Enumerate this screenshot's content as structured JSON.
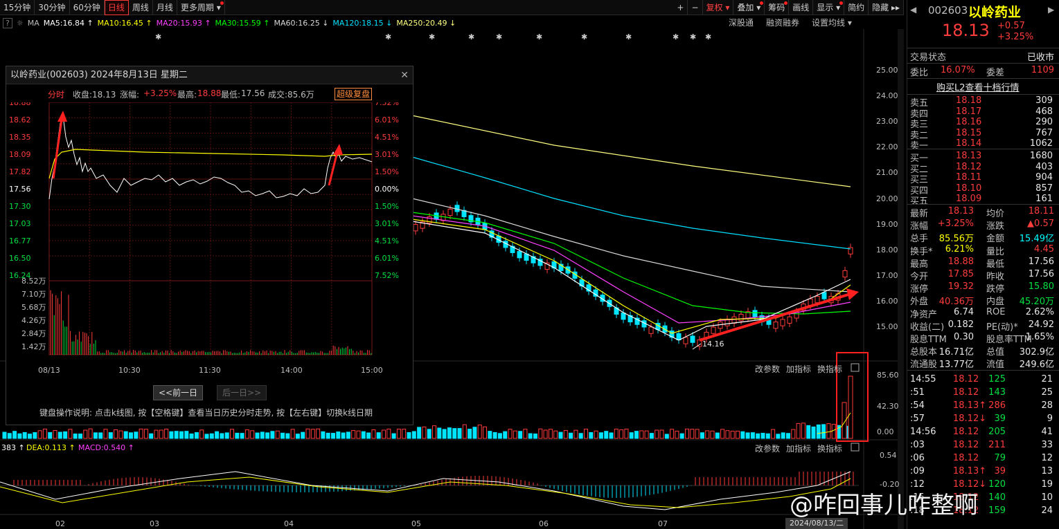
{
  "toolbar": {
    "periods": [
      "15分钟",
      "30分钟",
      "60分钟",
      "日线",
      "周线",
      "月线",
      "更多周期"
    ],
    "active": "日线",
    "right_items": [
      "+",
      "−",
      "复权",
      "叠加",
      "筹码",
      "画线",
      "显示",
      "简约",
      "隐藏"
    ]
  },
  "ma": {
    "prefix": "MA",
    "items": [
      {
        "label": "MA5:16.84",
        "color": "#ffffff"
      },
      {
        "label": "MA10:16.45",
        "color": "#ffff00"
      },
      {
        "label": "MA20:15.93",
        "color": "#ff40ff"
      },
      {
        "label": "MA30:15.59",
        "color": "#00ff00"
      },
      {
        "label": "MA60:16.25",
        "color": "#d8d8d8"
      },
      {
        "label": "MA120:18.15",
        "color": "#00e0ff"
      },
      {
        "label": "MA250:20.49",
        "color": "#ffff80"
      }
    ],
    "extras": [
      "深股通",
      "融资融券",
      "设置均线"
    ]
  },
  "axis": {
    "price_ticks": [
      "25.00",
      "24.00",
      "23.00",
      "22.00",
      "21.00",
      "20.00",
      "19.00",
      "18.00",
      "17.00",
      "16.00",
      "15.00"
    ],
    "vol_ticks": [
      "85.60",
      "42.30",
      "0.00"
    ],
    "macd_ticks": [
      "0.54",
      "-0.20"
    ],
    "months": [
      "02",
      "03",
      "04",
      "05",
      "06",
      "07"
    ],
    "low_label": "14.16"
  },
  "vol_panel": {
    "buttons": [
      "改参数",
      "加指标",
      "换指标"
    ]
  },
  "macd_panel": {
    "labels": [
      {
        "text": "383 ↑",
        "color": "#ffffff"
      },
      {
        "text": "DEA:0.113 ↑",
        "color": "#ffff00"
      },
      {
        "text": "MACD:0.540 ↑",
        "color": "#ff40ff"
      }
    ],
    "buttons": [
      "改参数",
      "加指标",
      "换指标"
    ]
  },
  "popup": {
    "title": "以岭药业(002603) 2024年8月13日 星期二",
    "tab": "分时",
    "close": "收盘:18.13",
    "change_label": "涨幅:",
    "change": "+3.25%",
    "high_label": "最高:",
    "high": "18.88",
    "low_label": "最低:",
    "low": "17.56",
    "volume": "成交:85.6万",
    "super_btn": "超级复盘",
    "left_ticks": [
      "18.88",
      "18.62",
      "18.35",
      "18.09",
      "17.82",
      "17.56",
      "17.30",
      "17.03",
      "16.77",
      "16.50",
      "16.24"
    ],
    "right_ticks": [
      "7.52%",
      "6.01%",
      "4.51%",
      "3.01%",
      "1.50%",
      "0.00%",
      "1.50%",
      "3.01%",
      "4.51%",
      "6.01%",
      "7.52%"
    ],
    "vol_ticks": [
      "8.52万",
      "7.10万",
      "5.68万",
      "4.26万",
      "2.84万",
      "1.42万"
    ],
    "time_ticks": [
      "08/13",
      "10:30",
      "11:30",
      "14:00",
      "15:00"
    ],
    "prev_btn": "<<前一日",
    "next_btn": "后一日>>",
    "help": "键盘操作说明: 点击k线图, 按【空格键】查看当日历史分时走势, 按【左右键】切换k线日期"
  },
  "stock": {
    "code": "002603",
    "name": "以岭药业",
    "price": "18.13",
    "change": "+0.57",
    "pct": "+3.25%"
  },
  "status": {
    "label": "交易状态",
    "value": "已收市"
  },
  "weibi": {
    "l1": "委比",
    "v1": "16.07%",
    "l2": "委差",
    "v2": "1109"
  },
  "l2_btn": "购买L2查看十档行情",
  "asks": [
    {
      "label": "卖五",
      "price": "18.18",
      "vol": "309"
    },
    {
      "label": "卖四",
      "price": "18.17",
      "vol": "468"
    },
    {
      "label": "卖三",
      "price": "18.16",
      "vol": "290"
    },
    {
      "label": "卖二",
      "price": "18.15",
      "vol": "767"
    },
    {
      "label": "卖一",
      "price": "18.14",
      "vol": "1062"
    }
  ],
  "bids": [
    {
      "label": "买一",
      "price": "18.13",
      "vol": "1680"
    },
    {
      "label": "买二",
      "price": "18.12",
      "vol": "403"
    },
    {
      "label": "买三",
      "price": "18.11",
      "vol": "904"
    },
    {
      "label": "买四",
      "price": "18.10",
      "vol": "857"
    },
    {
      "label": "买五",
      "price": "18.09",
      "vol": "161"
    }
  ],
  "stats": [
    {
      "l1": "最新",
      "v1": "18.13",
      "c1": "red",
      "l2": "均价",
      "v2": "18.11",
      "c2": "red"
    },
    {
      "l1": "涨幅",
      "v1": "+3.25%",
      "c1": "red",
      "l2": "涨跌",
      "v2": "▲0.57",
      "c2": "red"
    },
    {
      "l1": "总手",
      "v1": "85.56万",
      "c1": "yellow",
      "l2": "金额",
      "v2": "15.49亿",
      "c2": "cyan"
    },
    {
      "l1": "换手*",
      "v1": "6.21%",
      "c1": "yellow",
      "l2": "量比",
      "v2": "4.45",
      "c2": "red"
    },
    {
      "l1": "最高",
      "v1": "18.88",
      "c1": "red",
      "l2": "最低",
      "v2": "17.56",
      "c2": "white"
    },
    {
      "l1": "今开",
      "v1": "17.85",
      "c1": "red",
      "l2": "昨收",
      "v2": "17.56",
      "c2": "white"
    },
    {
      "l1": "涨停",
      "v1": "19.32",
      "c1": "red",
      "l2": "跌停",
      "v2": "15.80",
      "c2": "green"
    },
    {
      "l1": "外盘",
      "v1": "40.36万",
      "c1": "red",
      "l2": "内盘",
      "v2": "45.20万",
      "c2": "green"
    },
    {
      "l1": "净资产",
      "v1": "6.74",
      "c1": "white",
      "l2": "ROE",
      "v2": "2.62%",
      "c2": "white"
    },
    {
      "l1": "收益(二)",
      "v1": "0.182",
      "c1": "white",
      "l2": "PE(动)*",
      "v2": "24.92",
      "c2": "white"
    },
    {
      "l1": "股息TTM",
      "v1": "0.30",
      "c1": "white",
      "l2": "股息率TTM",
      "v2": "1.65%",
      "c2": "white"
    },
    {
      "l1": "总股本",
      "v1": "16.71亿",
      "c1": "white",
      "l2": "总值",
      "v2": "302.9亿",
      "c2": "white"
    },
    {
      "l1": "流通股",
      "v1": "13.77亿",
      "c1": "white",
      "l2": "流值",
      "v2": "249.6亿",
      "c2": "white"
    }
  ],
  "ticks": [
    {
      "t": "14:55",
      "p": "18.12",
      "arrow": "",
      "v": "125",
      "n": "21",
      "vc": "green"
    },
    {
      "t": ":51",
      "p": "18.12",
      "arrow": "",
      "v": "143",
      "n": "25",
      "vc": "green"
    },
    {
      "t": ":54",
      "p": "18.13",
      "arrow": "↑",
      "v": "286",
      "n": "28",
      "vc": "red"
    },
    {
      "t": ":57",
      "p": "18.12",
      "arrow": "↓",
      "v": "39",
      "n": "9",
      "vc": "green"
    },
    {
      "t": "14:56",
      "p": "18.12",
      "arrow": "",
      "v": "205",
      "n": "41",
      "vc": "green"
    },
    {
      "t": ":03",
      "p": "18.12",
      "arrow": "",
      "v": "211",
      "n": "33",
      "vc": "red"
    },
    {
      "t": ":06",
      "p": "18.12",
      "arrow": "",
      "v": "79",
      "n": "12",
      "vc": "green"
    },
    {
      "t": ":09",
      "p": "18.13",
      "arrow": "↑",
      "v": "39",
      "n": "13",
      "vc": "red"
    },
    {
      "t": ":12",
      "p": "18.12",
      "arrow": "↓",
      "v": "120",
      "n": "19",
      "vc": "green"
    },
    {
      "t": ":15",
      "p": "18.12",
      "arrow": "",
      "v": "140",
      "n": "10",
      "vc": "green"
    },
    {
      "t": ":18",
      "p": "18.12",
      "arrow": "",
      "v": "159",
      "n": "24",
      "vc": "green"
    }
  ],
  "watermark": "@咋回事儿咋整啊",
  "date_badge": "2024/08/13/二"
}
